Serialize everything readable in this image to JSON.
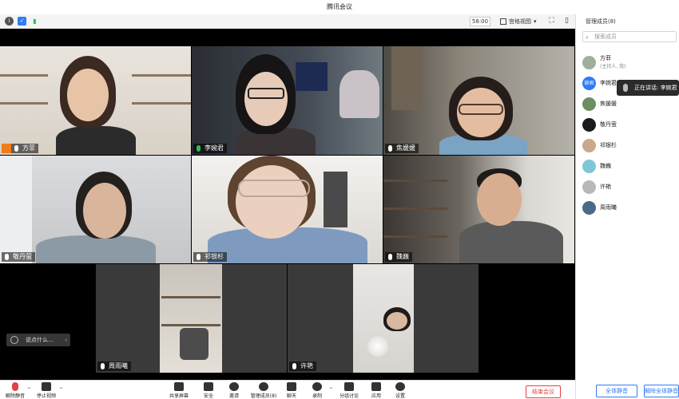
{
  "window": {
    "title": "腾讯会议"
  },
  "toolbar": {
    "timer": "58:00",
    "view_label": "宫格视图",
    "panel_toggle_label": "管理成员(8)"
  },
  "panel": {
    "search_placeholder": "搜索成员",
    "speaking_label": "正在讲话: 李婉君",
    "members": [
      {
        "name": "方菲",
        "sub": "(主持人, 我)",
        "avatar_color": "#9fb09a"
      },
      {
        "name": "李婉君",
        "sub": "",
        "avatar_color": "#2f7cf6",
        "avatar_text": "婉君"
      },
      {
        "name": "焦媛媛",
        "sub": "",
        "avatar_color": "#6b8f5e"
      },
      {
        "name": "敬丹萤",
        "sub": "",
        "avatar_color": "#1b1b1b"
      },
      {
        "name": "祁银杉",
        "sub": "",
        "avatar_color": "#c9a98a"
      },
      {
        "name": "魏巍",
        "sub": "",
        "avatar_color": "#7fc6d8"
      },
      {
        "name": "许艳",
        "sub": "",
        "avatar_color": "#b9b9b9"
      },
      {
        "name": "周雨曦",
        "sub": "",
        "avatar_color": "#4a6a8a"
      }
    ],
    "mute_all_label": "全体静音",
    "unmute_all_label": "解除全体静音"
  },
  "video": {
    "tiles": [
      {
        "name": "方菲"
      },
      {
        "name": "李婉君"
      },
      {
        "name": "焦媛媛"
      },
      {
        "name": "敬丹萤"
      },
      {
        "name": "祁银杉"
      },
      {
        "name": "魏巍"
      },
      {
        "name": "周雨曦"
      },
      {
        "name": "许艳"
      }
    ],
    "chat_placeholder": "说点什么..."
  },
  "controls": {
    "unmute": "解除静音",
    "stop_video": "停止视频",
    "share_screen": "共享屏幕",
    "security": "安全",
    "invite": "邀请",
    "manage_members": "管理成员(8)",
    "chat": "聊天",
    "record": "录制",
    "breakout": "分组讨论",
    "apps": "应用",
    "settings": "设置",
    "end_meeting": "结束会议"
  },
  "colors": {
    "accent": "#2f7cf6",
    "active_speaker": "#2fbd4c",
    "end_meeting": "#e04343",
    "host_badge": "#f07d1a"
  }
}
